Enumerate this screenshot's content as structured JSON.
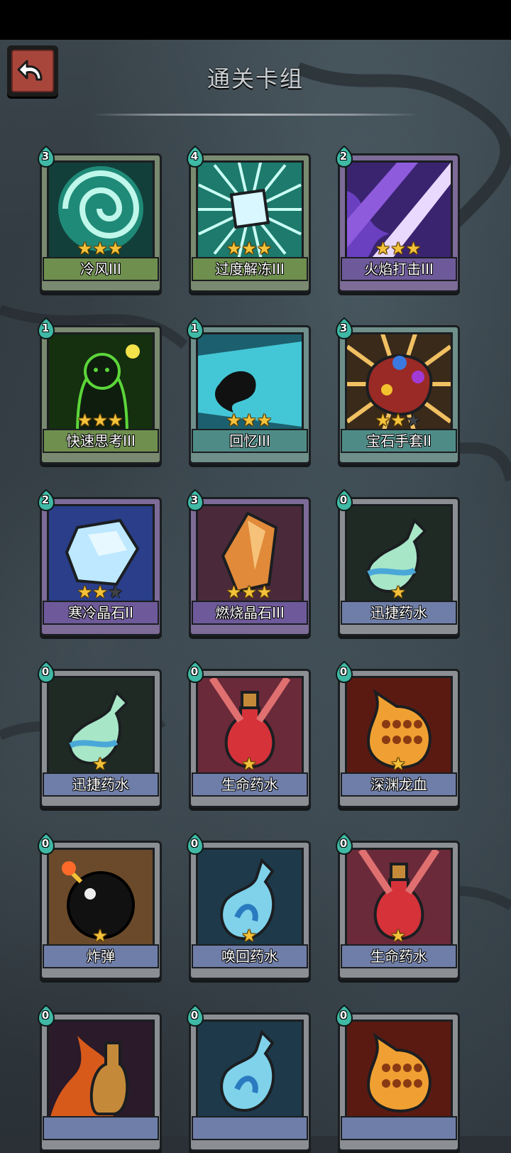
{
  "header": {
    "title": "通关卡组",
    "back_icon": "back-arrow-icon"
  },
  "colors": {
    "rarity_green": "#6f8f4e",
    "rarity_purple": "#6e5a9a",
    "rarity_teal": "#4f8b86",
    "rarity_blue": "#6f7ea8",
    "star": "#f4c23a"
  },
  "cards": [
    {
      "name": "冷风III",
      "cost": "3",
      "stars": 3,
      "max_stars": 3,
      "rarity": "green",
      "icon": "cold-wind-swirl-icon"
    },
    {
      "name": "过度解冻III",
      "cost": "4",
      "stars": 3,
      "max_stars": 3,
      "rarity": "green",
      "icon": "ice-cube-burst-icon"
    },
    {
      "name": "火焰打击III",
      "cost": "2",
      "stars": 3,
      "max_stars": 3,
      "rarity": "purple",
      "icon": "flame-strike-icon"
    },
    {
      "name": "快速思考III",
      "cost": "1",
      "stars": 3,
      "max_stars": 3,
      "rarity": "green",
      "icon": "quick-think-figure-icon"
    },
    {
      "name": "回忆III",
      "cost": "1",
      "stars": 3,
      "max_stars": 3,
      "rarity": "teal",
      "icon": "recall-wisp-icon"
    },
    {
      "name": "宝石手套II",
      "cost": "3",
      "stars": 2,
      "max_stars": 3,
      "rarity": "teal",
      "icon": "gem-gauntlet-icon"
    },
    {
      "name": "寒冷晶石II",
      "cost": "2",
      "stars": 2,
      "max_stars": 3,
      "rarity": "purple",
      "icon": "frost-crystal-icon"
    },
    {
      "name": "燃烧晶石III",
      "cost": "3",
      "stars": 3,
      "max_stars": 3,
      "rarity": "purple",
      "icon": "burning-crystal-icon"
    },
    {
      "name": "迅捷药水",
      "cost": "0",
      "stars": 1,
      "max_stars": 1,
      "rarity": "blue",
      "icon": "swift-potion-icon"
    },
    {
      "name": "迅捷药水",
      "cost": "0",
      "stars": 1,
      "max_stars": 1,
      "rarity": "blue",
      "icon": "swift-potion-icon"
    },
    {
      "name": "生命药水",
      "cost": "0",
      "stars": 1,
      "max_stars": 1,
      "rarity": "blue",
      "icon": "health-potion-icon"
    },
    {
      "name": "深渊龙血",
      "cost": "0",
      "stars": 1,
      "max_stars": 1,
      "rarity": "blue",
      "icon": "abyss-dragon-blood-icon"
    },
    {
      "name": "炸弹",
      "cost": "0",
      "stars": 1,
      "max_stars": 1,
      "rarity": "blue",
      "icon": "bomb-icon"
    },
    {
      "name": "唤回药水",
      "cost": "0",
      "stars": 1,
      "max_stars": 1,
      "rarity": "blue",
      "icon": "recall-potion-icon"
    },
    {
      "name": "生命药水",
      "cost": "0",
      "stars": 1,
      "max_stars": 1,
      "rarity": "blue",
      "icon": "health-potion-icon"
    },
    {
      "name": "",
      "cost": "0",
      "stars": 0,
      "max_stars": 0,
      "rarity": "blue",
      "icon": "fire-flask-icon"
    },
    {
      "name": "",
      "cost": "0",
      "stars": 0,
      "max_stars": 0,
      "rarity": "blue",
      "icon": "recall-potion-icon"
    },
    {
      "name": "",
      "cost": "0",
      "stars": 0,
      "max_stars": 0,
      "rarity": "blue",
      "icon": "abyss-dragon-blood-icon"
    }
  ]
}
